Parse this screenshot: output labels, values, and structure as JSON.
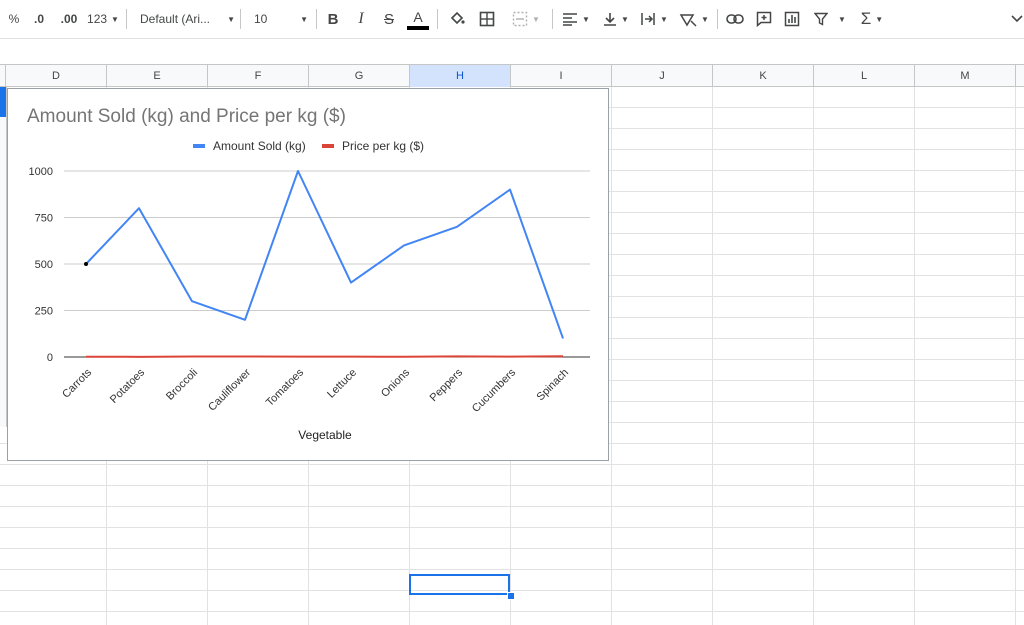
{
  "toolbar": {
    "percent": "%",
    "decrease_decimal": ".0",
    "increase_decimal": ".00",
    "more_formats": "123",
    "font_family": "Default (Ari...",
    "font_size": "10",
    "bold": "B",
    "italic": "I",
    "strikethrough": "S",
    "text_color": "A",
    "functions": "Σ"
  },
  "columns": [
    "D",
    "E",
    "F",
    "G",
    "H",
    "I",
    "J",
    "K",
    "L",
    "M"
  ],
  "selected_column": "H",
  "colors": {
    "series_amount": "#4285f4",
    "series_price": "#db4437",
    "selection": "#1a73e8"
  },
  "chart_data": {
    "type": "line",
    "title": "Amount Sold (kg) and Price per kg ($)",
    "xlabel": "Vegetable",
    "ylabel": "",
    "categories": [
      "Carrots",
      "Potatoes",
      "Broccoli",
      "Cauliflower",
      "Tomatoes",
      "Lettuce",
      "Onions",
      "Peppers",
      "Cucumbers",
      "Spinach"
    ],
    "series": [
      {
        "name": "Amount Sold (kg)",
        "values": [
          500,
          800,
          300,
          200,
          1000,
          400,
          600,
          700,
          900,
          100
        ]
      },
      {
        "name": "Price per kg ($)",
        "values": [
          1.5,
          1,
          3,
          2.5,
          2,
          1.8,
          1.2,
          3.5,
          2.2,
          4
        ]
      }
    ],
    "ylim": [
      0,
      1000
    ],
    "yticks": [
      "0",
      "250",
      "500",
      "750",
      "1000"
    ],
    "grid": true,
    "legend": "top"
  }
}
